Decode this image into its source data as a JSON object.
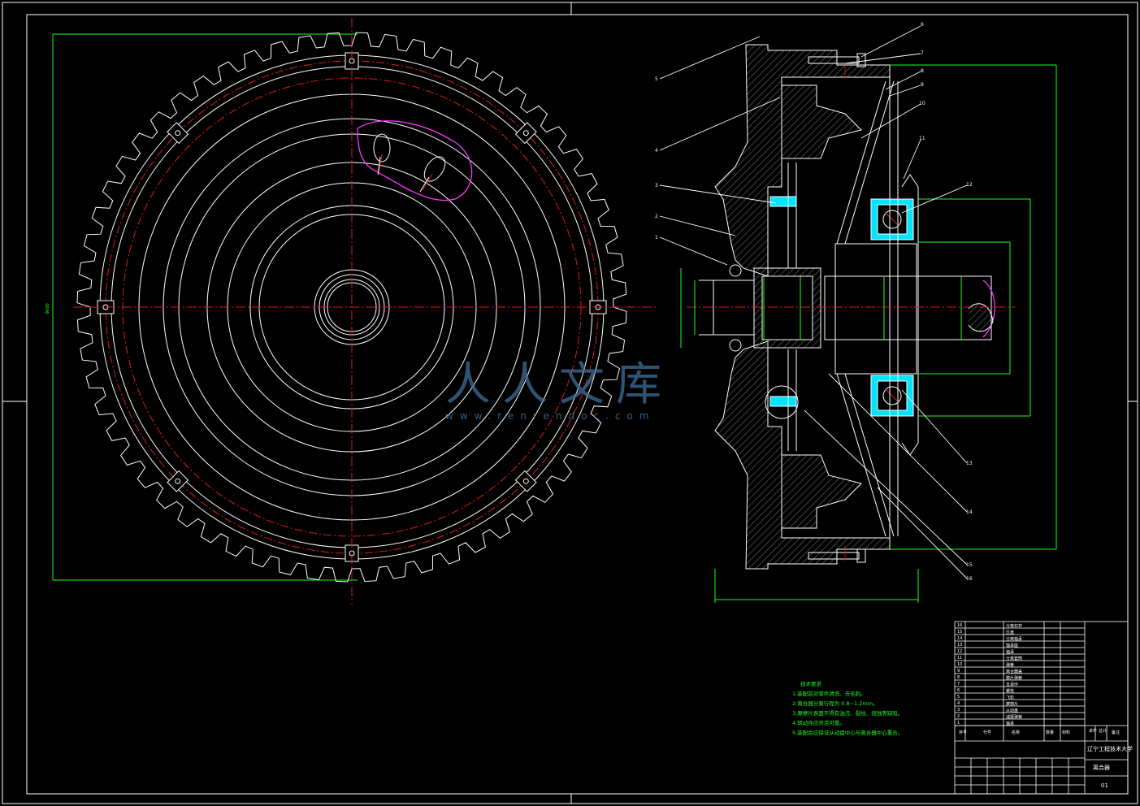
{
  "callouts": [
    "1",
    "2",
    "3",
    "4",
    "5",
    "6",
    "7",
    "8",
    "9",
    "10",
    "11",
    "12",
    "13",
    "14",
    "15",
    "16"
  ],
  "tech_notes": {
    "title": "技术要求",
    "items": [
      "1.装配前对零件清洗、去毛刺。",
      "2.离合器分离行程为 0.8~1.2mm。",
      "3.摩擦片表面不得有油污、裂纹、烧蚀等缺陷。",
      "4.转动件应灵活可靠。",
      "5.装配后应保证从动盘中心与离合器中心重合。"
    ]
  },
  "title_block": {
    "school": "辽宁工程技术大学",
    "drawing_title": "离合器",
    "drawing_no": "01",
    "header_labels": [
      "序号",
      "代号",
      "名称",
      "数量",
      "材料",
      "单件",
      "总计",
      "备注"
    ],
    "rows": [
      {
        "no": "16",
        "code": "",
        "name": "分离杠杆",
        "qty": "",
        "mat": ""
      },
      {
        "no": "15",
        "code": "",
        "name": "压盘",
        "qty": "",
        "mat": ""
      },
      {
        "no": "14",
        "code": "",
        "name": "分离轴承",
        "qty": "",
        "mat": ""
      },
      {
        "no": "13",
        "code": "",
        "name": "轴承座",
        "qty": "",
        "mat": ""
      },
      {
        "no": "12",
        "code": "",
        "name": "轴承",
        "qty": "",
        "mat": ""
      },
      {
        "no": "11",
        "code": "",
        "name": "分离套筒",
        "qty": "",
        "mat": ""
      },
      {
        "no": "10",
        "code": "",
        "name": "弹簧",
        "qty": "",
        "mat": ""
      },
      {
        "no": "9",
        "code": "",
        "name": "离合器盖",
        "qty": "",
        "mat": ""
      },
      {
        "no": "8",
        "code": "",
        "name": "膜片弹簧",
        "qty": "",
        "mat": ""
      },
      {
        "no": "7",
        "code": "",
        "name": "支承环",
        "qty": "",
        "mat": ""
      },
      {
        "no": "6",
        "code": "",
        "name": "螺栓",
        "qty": "",
        "mat": ""
      },
      {
        "no": "5",
        "code": "",
        "name": "飞轮",
        "qty": "",
        "mat": ""
      },
      {
        "no": "4",
        "code": "",
        "name": "摩擦片",
        "qty": "",
        "mat": ""
      },
      {
        "no": "3",
        "code": "",
        "name": "从动盘",
        "qty": "",
        "mat": ""
      },
      {
        "no": "2",
        "code": "",
        "name": "减振弹簧",
        "qty": "",
        "mat": ""
      },
      {
        "no": "1",
        "code": "",
        "name": "轴承",
        "qty": "",
        "mat": ""
      }
    ]
  },
  "watermark": {
    "text": "人人文库",
    "url": "www.renrendoc.com"
  },
  "colors": {
    "background": "#000000",
    "line": "#ffffff",
    "red": "#e01818",
    "green": "#19ff19",
    "cyan": "#00e5ff",
    "magenta": "#ff33ff",
    "hatch": "#6a6a6a"
  }
}
